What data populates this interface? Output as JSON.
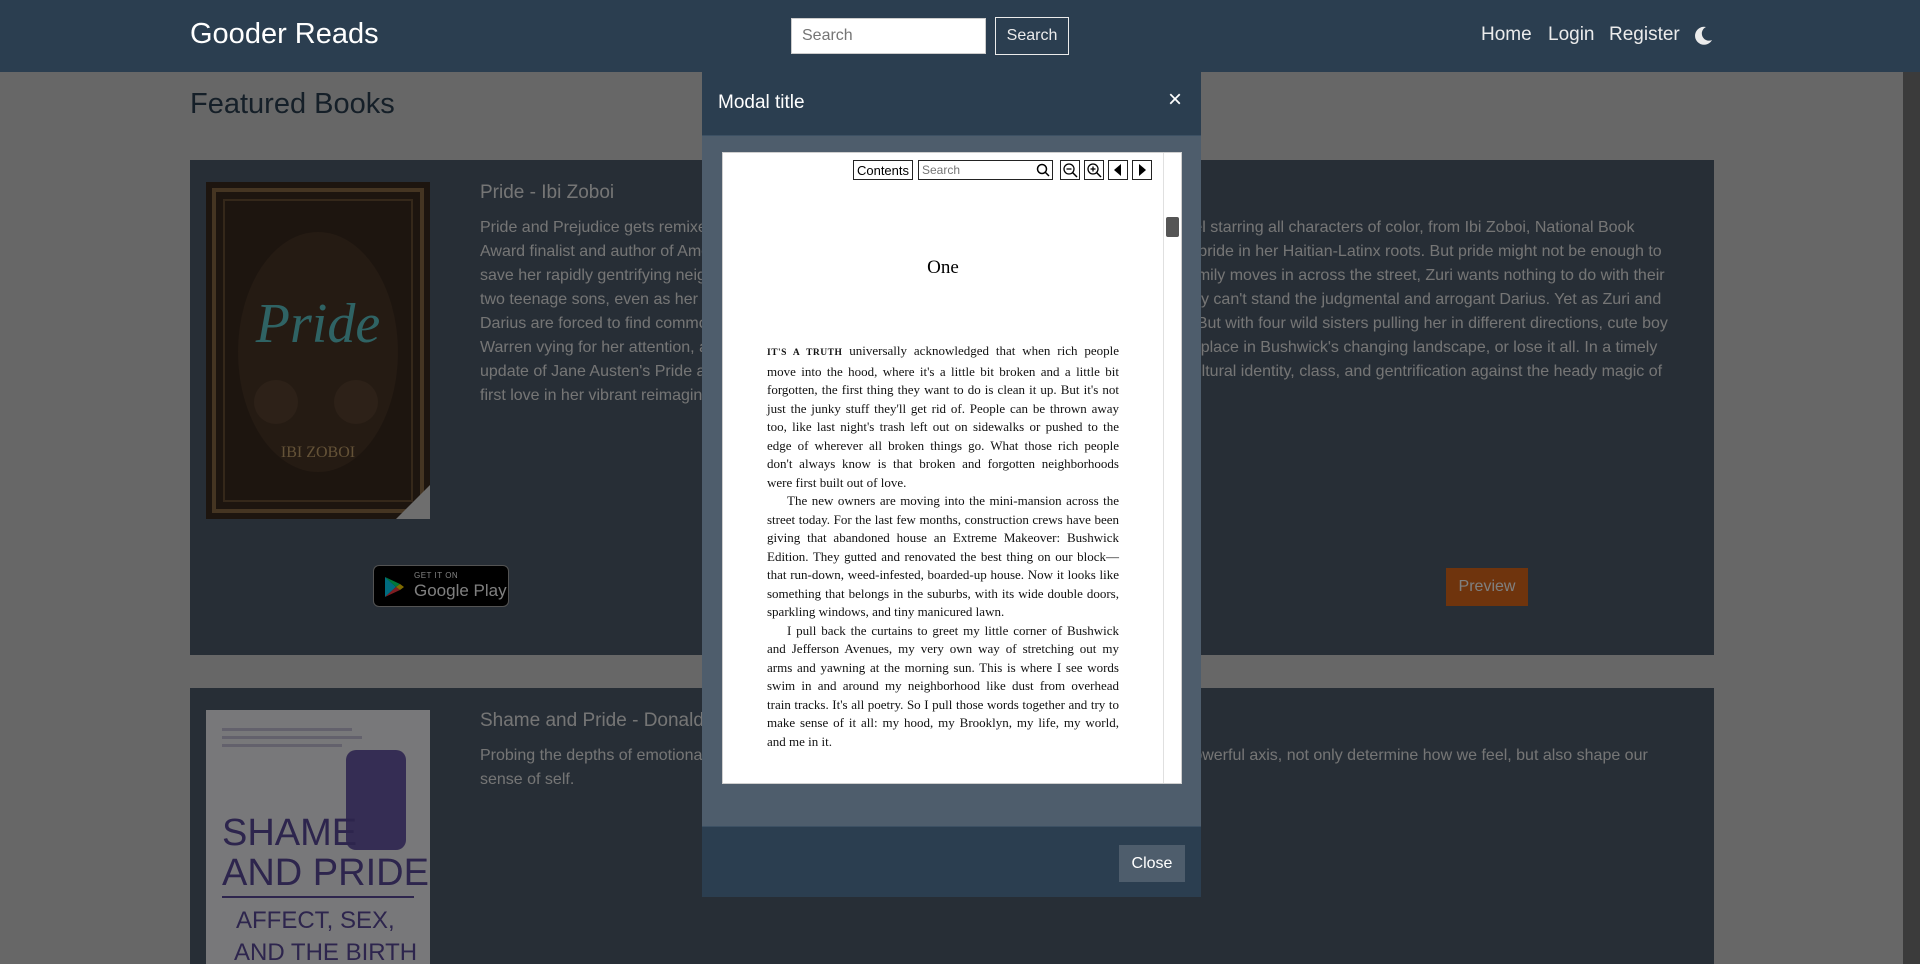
{
  "navbar": {
    "brand": "Gooder Reads",
    "search_placeholder": "Search",
    "search_button": "Search",
    "links": [
      "Home",
      "Login",
      "Register"
    ],
    "theme_toggle_icon": "moon-icon"
  },
  "page": {
    "title": "Featured Books"
  },
  "books": [
    {
      "title": "Pride - Ibi Zoboi",
      "description": "Pride and Prejudice gets remixed in this smart, funny, gorgeous retelling of Jane Austen's classic novel starring all characters of color, from Ibi Zoboi, National Book Award finalist and author of American Street. Zuri Benitez has pride. Brooklyn pride, family pride, and pride in her Haitian-Latinx roots. But pride might not be enough to save her rapidly gentrifying neighborhood from becoming unrecognizable. When the wealthy Darcy family moves in across the street, Zuri wants nothing to do with their two teenage sons, even as her older sister, Janae, starts to fall for the charming Ainsley. She especially can't stand the judgmental and arrogant Darius. Yet as Zuri and Darius are forced to find common ground, their initial dislike shifts into an unexpected understanding. But with four wild sisters pulling her in different directions, cute boy Warren vying for her attention, and college applications hovering on the horizon, Zuri fights to find her place in Bushwick's changing landscape, or lose it all. In a timely update of Jane Austen's Pride and Prejudice, critically acclaimed author Ibi Zoboi skillfully balances cultural identity, class, and gentrification against the heady magic of first love in her vibrant reimagining of this beloved classic.",
      "store_badge_small": "GET IT ON",
      "store_badge_big": "Google Play",
      "preview_button": "Preview",
      "cover_title": "Pride",
      "cover_author": "IBI ZOBOI"
    },
    {
      "title": "Shame and Pride - Donald L. Nathanson",
      "description": "Probing the depths of emotional life, Nathanson shows how shame and pride, as the two poles of a powerful axis, not only determine how we feel, but also shape our sense of self.",
      "cover_title_line1": "SHAME",
      "cover_title_line2": "AND PRIDE",
      "cover_sub1": "AFFECT, SEX,",
      "cover_sub2": "AND THE BIRTH"
    }
  ],
  "modal": {
    "title": "Modal title",
    "close_x": "×",
    "close_button": "Close",
    "reader": {
      "contents_button": "Contents",
      "search_placeholder": "Search",
      "chapter": "One",
      "paragraph1_lead": "IT'S A TRUTH",
      "paragraph1": " universally acknowledged that when rich people move into the hood, where it's a little bit broken and a little bit forgotten, the first thing they want to do is clean it up. But it's not just the junky stuff they'll get rid of. People can be thrown away too, like last night's trash left out on sidewalks or pushed to the edge of wherever all broken things go. What those rich people don't always know is that broken and forgotten neighborhoods were first built out of love.",
      "paragraph2": "The new owners are moving into the mini-mansion across the street today. For the last few months, construction crews have been giving that abandoned house an Extreme Makeover: Bushwick Edition. They gutted and renovated the best thing on our block—that run-down, weed-infested, boarded-up house. Now it looks like something that belongs in the suburbs, with its wide double doors, sparkling windows, and tiny manicured lawn.",
      "paragraph3": "I pull back the curtains to greet my little corner of Bushwick and Jefferson Avenues, my very own way of stretching out my arms and yawning at the morning sun. This is where I see words swim in and around my neighborhood like dust from overhead train tracks. It's all poetry. So I pull those words together and try to make sense of it all: my hood, my Brooklyn, my life, my world, and me in it."
    }
  }
}
